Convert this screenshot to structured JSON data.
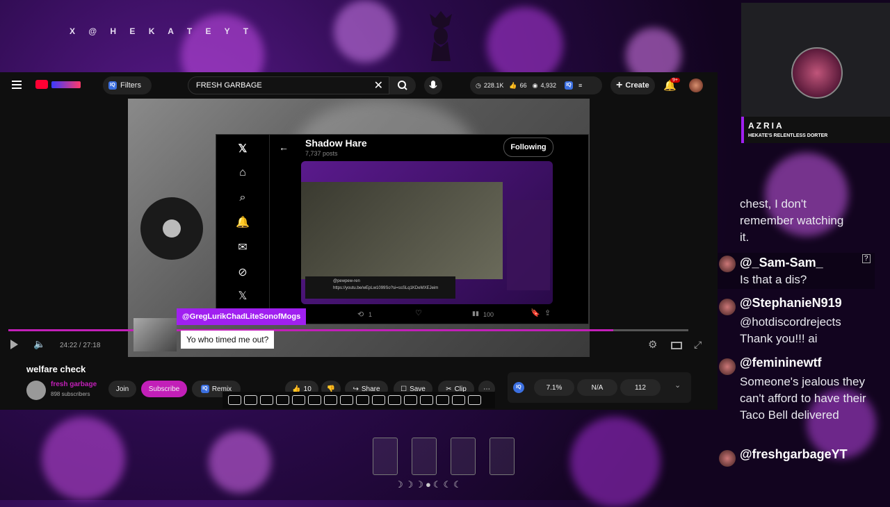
{
  "overlay": {
    "handle": "X @ H E K A T E Y T",
    "streamer_name": "AZRIA",
    "streamer_subtitle": "HEKATE'S RELENTLESS DORTER"
  },
  "youtube": {
    "search_value": "FRESH GARBAGE",
    "filters_label": "Filters",
    "stats": {
      "views": "228.1K",
      "likes": "66",
      "watching": "4,932"
    },
    "create_label": "Create",
    "notif_badge": "9+",
    "time": "24:22 / 27:18",
    "video_title": "welfare check",
    "channel_name": "fresh garbage",
    "subscribers": "898 subscribers",
    "join_label": "Join",
    "subscribe_label": "Subscribe",
    "remix_label": "Remix",
    "like_count": "10",
    "share_label": "Share",
    "save_label": "Save",
    "clip_label": "Clip",
    "iq_stats": [
      "7.1%",
      "N/A",
      "112"
    ]
  },
  "xpost": {
    "profile_name": "Shadow Hare",
    "posts": "7,737 posts",
    "following_label": "Following",
    "embedded_user": "@pewpew-ren",
    "embedded_link": "https://youtu.be/wEpLw1099So?si=ssSLq1KDeMXEJeim",
    "retweets": "1",
    "views": "100"
  },
  "stream_chat_overlay": {
    "user": "@GregLurikChadLiteSonofMogs",
    "text": "Yo who timed me out?"
  },
  "chat": [
    {
      "user": "",
      "text": "chest, I don't remember watching it."
    },
    {
      "user": "@_Sam-Sam_",
      "text": "Is that a dis?"
    },
    {
      "user": "@StephanieN919",
      "text": "@hotdiscordrejects Thank you!!! ai"
    },
    {
      "user": "@femininewtf",
      "text": "Someone's jealous they can't afford to have their Taco Bell delivered"
    },
    {
      "user": "@freshgarbageYT",
      "text": ""
    }
  ],
  "colors": {
    "accent_purple": "#a020f0",
    "subscribe": "#c21fb8",
    "youtube_red": "#ff0033"
  }
}
